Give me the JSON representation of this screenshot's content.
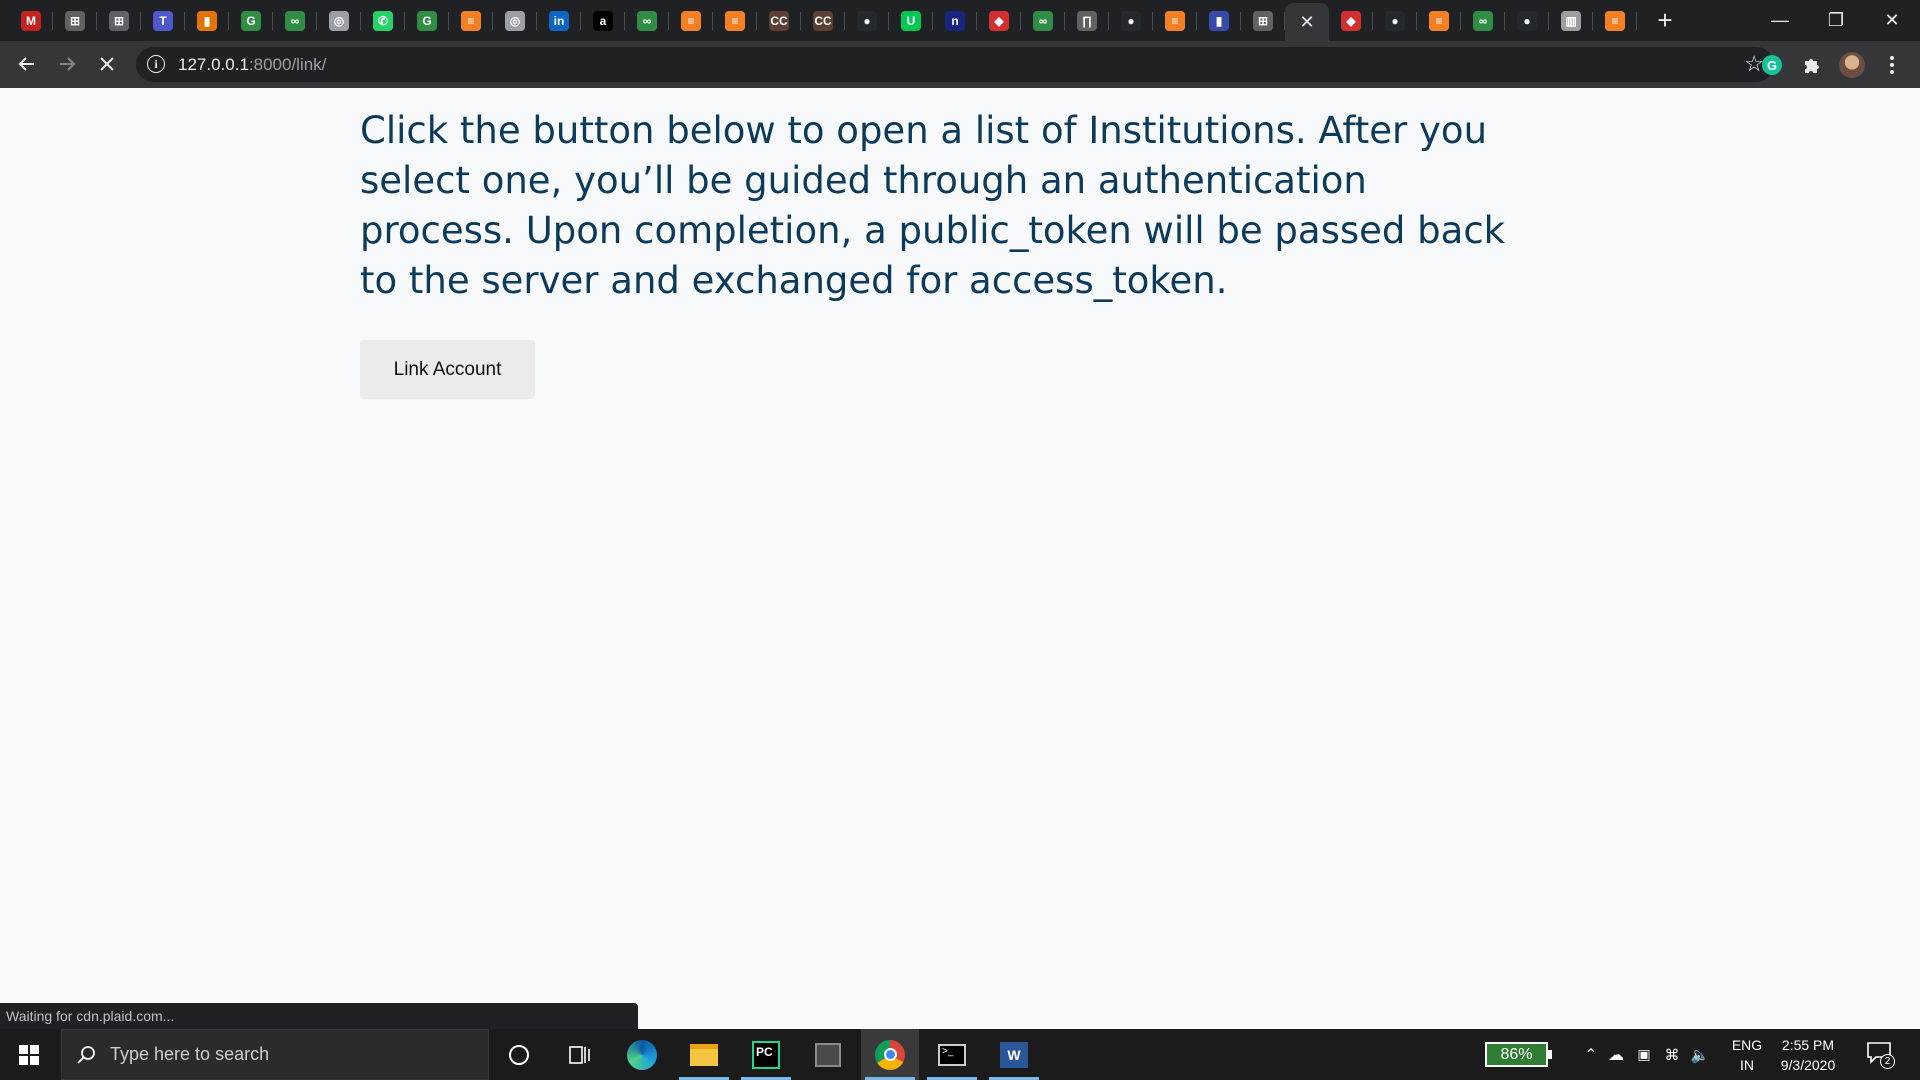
{
  "browser": {
    "tabs": [
      {
        "icon": "gmail-icon",
        "glyph": "M",
        "color": "#c5221f"
      },
      {
        "icon": "generic-site-icon",
        "glyph": "⊞",
        "color": "#5f6368"
      },
      {
        "icon": "generic-site-icon",
        "glyph": "⊞",
        "color": "#5f6368"
      },
      {
        "icon": "teams-icon",
        "glyph": "T",
        "color": "#5059c9"
      },
      {
        "icon": "chart-icon",
        "glyph": "▮",
        "color": "#e37400"
      },
      {
        "icon": "geeksforgeeks-icon",
        "glyph": "G",
        "color": "#2f8d46"
      },
      {
        "icon": "geeksforgeeks-icon",
        "glyph": "∞",
        "color": "#2f8d46"
      },
      {
        "icon": "circle-site-icon",
        "glyph": "◎",
        "color": "#9aa0a6"
      },
      {
        "icon": "whatsapp-icon",
        "glyph": "✆",
        "color": "#25d366"
      },
      {
        "icon": "geeksforgeeks-icon",
        "glyph": "G",
        "color": "#2f8d46"
      },
      {
        "icon": "stackoverflow-icon",
        "glyph": "≡",
        "color": "#f48024"
      },
      {
        "icon": "circle-site-icon",
        "glyph": "◎",
        "color": "#9aa0a6"
      },
      {
        "icon": "linkedin-icon",
        "glyph": "in",
        "color": "#0a66c2"
      },
      {
        "icon": "amazon-icon",
        "glyph": "a",
        "color": "#000000"
      },
      {
        "icon": "geeksforgeeks-icon",
        "glyph": "∞",
        "color": "#2f8d46"
      },
      {
        "icon": "stackoverflow-icon",
        "glyph": "≡",
        "color": "#f48024"
      },
      {
        "icon": "stackoverflow-icon",
        "glyph": "≡",
        "color": "#f48024"
      },
      {
        "icon": "cc-icon",
        "glyph": "CC",
        "color": "#5c4033"
      },
      {
        "icon": "cc-icon",
        "glyph": "CC",
        "color": "#5c4033"
      },
      {
        "icon": "github-icon",
        "glyph": "●",
        "color": "#24292e"
      },
      {
        "icon": "green-site-icon",
        "glyph": "U",
        "color": "#00c853"
      },
      {
        "icon": "notion-n-icon",
        "glyph": "n",
        "color": "#1a237e"
      },
      {
        "icon": "red-box-icon",
        "glyph": "◆",
        "color": "#d32f2f"
      },
      {
        "icon": "geeksforgeeks-icon",
        "glyph": "∞",
        "color": "#2f8d46"
      },
      {
        "icon": "figure-icon",
        "glyph": "∏",
        "color": "#616161"
      },
      {
        "icon": "github-icon",
        "glyph": "●",
        "color": "#24292e"
      },
      {
        "icon": "stackoverflow-icon",
        "glyph": "≡",
        "color": "#f48024"
      },
      {
        "icon": "purple-site-icon",
        "glyph": "▮",
        "color": "#3949ab"
      },
      {
        "icon": "generic-site-icon",
        "glyph": "⊞",
        "color": "#5f6368"
      },
      {
        "icon": "loading-tab-icon",
        "glyph": "",
        "color": "#35363a",
        "active": true
      },
      {
        "icon": "red-box-icon",
        "glyph": "◆",
        "color": "#d32f2f"
      },
      {
        "icon": "github-icon",
        "glyph": "●",
        "color": "#24292e"
      },
      {
        "icon": "stackoverflow-icon",
        "glyph": "≡",
        "color": "#f48024"
      },
      {
        "icon": "geeksforgeeks-icon",
        "glyph": "∞",
        "color": "#2f8d46"
      },
      {
        "icon": "github-icon",
        "glyph": "●",
        "color": "#24292e"
      },
      {
        "icon": "book-icon",
        "glyph": "▥",
        "color": "#9e9e9e"
      },
      {
        "icon": "stackoverflow-icon",
        "glyph": "≡",
        "color": "#f48024"
      }
    ],
    "url_host": "127.0.0.1",
    "url_rest": ":8000/link/",
    "status_text": "Waiting for cdn.plaid.com..."
  },
  "page": {
    "intro_text": "Click the button below to open a list of Institutions. After you select one, you’ll be guided through an authentication process. Upon completion, a public_token will be passed back to the server and exchanged for access_token.",
    "link_button_label": "Link Account"
  },
  "taskbar": {
    "search_placeholder": "Type here to search",
    "battery_percent": "86%",
    "lang_line1": "ENG",
    "lang_line2": "IN",
    "time": "2:55 PM",
    "date": "9/3/2020",
    "notification_count": "2"
  }
}
